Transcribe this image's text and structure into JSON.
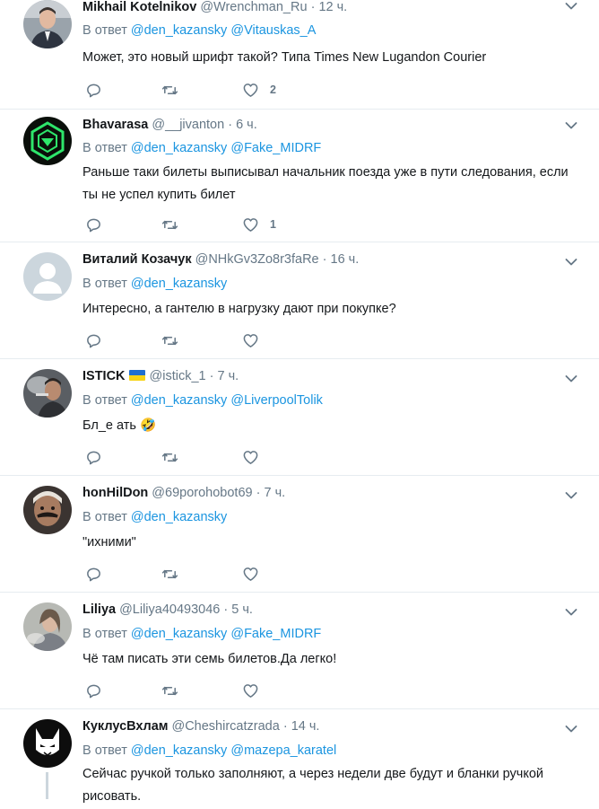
{
  "reply_prefix": "В ответ",
  "tweets": [
    {
      "name": "Mikhail Kotelnikov",
      "handle": "@Wrenchman_Ru",
      "time": "12 ч.",
      "mentions": [
        "@den_kazansky",
        "@Vitauskas_A"
      ],
      "text": "Может,  это новый шрифт такой? Типа Times New Lugandon Courier",
      "likes": "2",
      "avatar": "avatar-man-suit"
    },
    {
      "name": "Bhavarasa",
      "handle": "@__jivanton",
      "time": "6 ч.",
      "mentions": [
        "@den_kazansky",
        "@Fake_MIDRF"
      ],
      "text": "Раньше таки билеты выписывал начальник поезда уже в пути следования, если ты не успел купить билет",
      "likes": "1",
      "avatar": "avatar-green-logo"
    },
    {
      "name": "Виталий Козачук",
      "handle": "@NHkGv3Zo8r3faRe",
      "time": "16 ч.",
      "mentions": [
        "@den_kazansky"
      ],
      "text": "Интересно, а гантелю в нагрузку дают при покупке?",
      "likes": "",
      "avatar": "avatar-default"
    },
    {
      "name": "ISTICK",
      "handle": "@istick_1",
      "time": "7 ч.",
      "mentions": [
        "@den_kazansky",
        "@LiverpoolTolik"
      ],
      "text": "Бл_е  ать 🤣",
      "likes": "",
      "avatar": "avatar-smoke"
    },
    {
      "name": "honHilDon",
      "handle": "@69porohobot69",
      "time": "7 ч.",
      "mentions": [
        "@den_kazansky"
      ],
      "text": "\"ихними\"",
      "likes": "",
      "avatar": "avatar-mustache"
    },
    {
      "name": "Liliya",
      "handle": "@Liliya40493046",
      "time": "5 ч.",
      "mentions": [
        "@den_kazansky",
        "@Fake_MIDRF"
      ],
      "text": "Чё там писать эти семь билетов.Да легко!",
      "likes": "",
      "avatar": "avatar-woman"
    },
    {
      "name": "КуклусВхлам",
      "handle": "@Cheshircatzrada",
      "time": "14 ч.",
      "mentions": [
        "@den_kazansky",
        "@mazepa_karatel"
      ],
      "text": "Сейчас ручкой только заполняют, а через недели две будут и бланки ручкой рисовать.",
      "likes": "",
      "avatar": "avatar-cat-mask"
    }
  ],
  "colors": {
    "link": "#1b95e0",
    "secondary": "#657786",
    "border": "#e6ecf0"
  }
}
